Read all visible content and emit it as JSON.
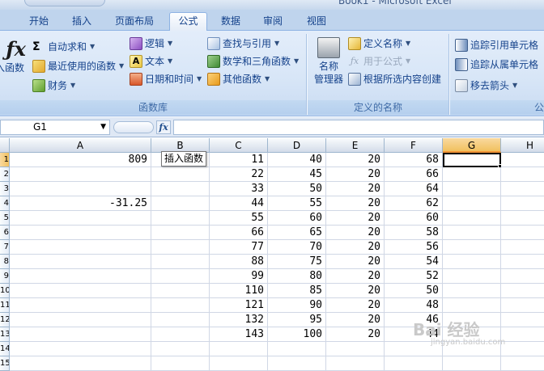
{
  "window": {
    "title": "Book1 - Microsoft Excel"
  },
  "tabs": [
    {
      "label": "开始",
      "active": false
    },
    {
      "label": "插入",
      "active": false
    },
    {
      "label": "页面布局",
      "active": false
    },
    {
      "label": "公式",
      "active": true
    },
    {
      "label": "数据",
      "active": false
    },
    {
      "label": "审阅",
      "active": false
    },
    {
      "label": "视图",
      "active": false
    }
  ],
  "ribbon": {
    "insert_function": {
      "label": "入函数",
      "icon": "fx-icon"
    },
    "library": {
      "autosum": "自动求和",
      "recent": "最近使用的函数",
      "financial": "财务",
      "logical": "逻辑",
      "text": "文本",
      "datetime": "日期和时间",
      "lookup": "查找与引用",
      "math": "数学和三角函数",
      "more": "其他函数",
      "group_label": "函数库"
    },
    "names": {
      "manager_line1": "名称",
      "manager_line2": "管理器",
      "define": "定义名称",
      "use_in_formula": "用于公式",
      "create_from_selection": "根据所选内容创建",
      "group_label": "定义的名称"
    },
    "auditing": {
      "trace_precedents": "追踪引用单元格",
      "trace_dependents": "追踪从属单元格",
      "remove_arrows": "移去箭头",
      "group_label_partial": "公"
    }
  },
  "formula_bar": {
    "name_box": "G1",
    "formula": "",
    "fx_label": "fx"
  },
  "tooltip": {
    "text": "插入函数"
  },
  "columns": [
    "A",
    "B",
    "C",
    "D",
    "E",
    "F",
    "G",
    "H"
  ],
  "selected_cell": "G1",
  "rows": [
    {
      "num": "1",
      "A": "809",
      "C": "11",
      "D": "40",
      "E": "20",
      "F": "68"
    },
    {
      "num": "2",
      "C": "22",
      "D": "45",
      "E": "20",
      "F": "66"
    },
    {
      "num": "3",
      "C": "33",
      "D": "50",
      "E": "20",
      "F": "64"
    },
    {
      "num": "4",
      "A": "-31.25",
      "C": "44",
      "D": "55",
      "E": "20",
      "F": "62"
    },
    {
      "num": "5",
      "C": "55",
      "D": "60",
      "E": "20",
      "F": "60"
    },
    {
      "num": "6",
      "C": "66",
      "D": "65",
      "E": "20",
      "F": "58"
    },
    {
      "num": "7",
      "C": "77",
      "D": "70",
      "E": "20",
      "F": "56"
    },
    {
      "num": "8",
      "C": "88",
      "D": "75",
      "E": "20",
      "F": "54"
    },
    {
      "num": "9",
      "C": "99",
      "D": "80",
      "E": "20",
      "F": "52"
    },
    {
      "num": "10",
      "C": "110",
      "D": "85",
      "E": "20",
      "F": "50"
    },
    {
      "num": "11",
      "C": "121",
      "D": "90",
      "E": "20",
      "F": "48"
    },
    {
      "num": "12",
      "C": "132",
      "D": "95",
      "E": "20",
      "F": "46"
    },
    {
      "num": "13",
      "C": "143",
      "D": "100",
      "E": "20",
      "F": "44"
    },
    {
      "num": "14"
    },
    {
      "num": "15"
    }
  ],
  "watermark": {
    "brand": "Bai 经验",
    "url": "jingyan.baidu.com"
  }
}
